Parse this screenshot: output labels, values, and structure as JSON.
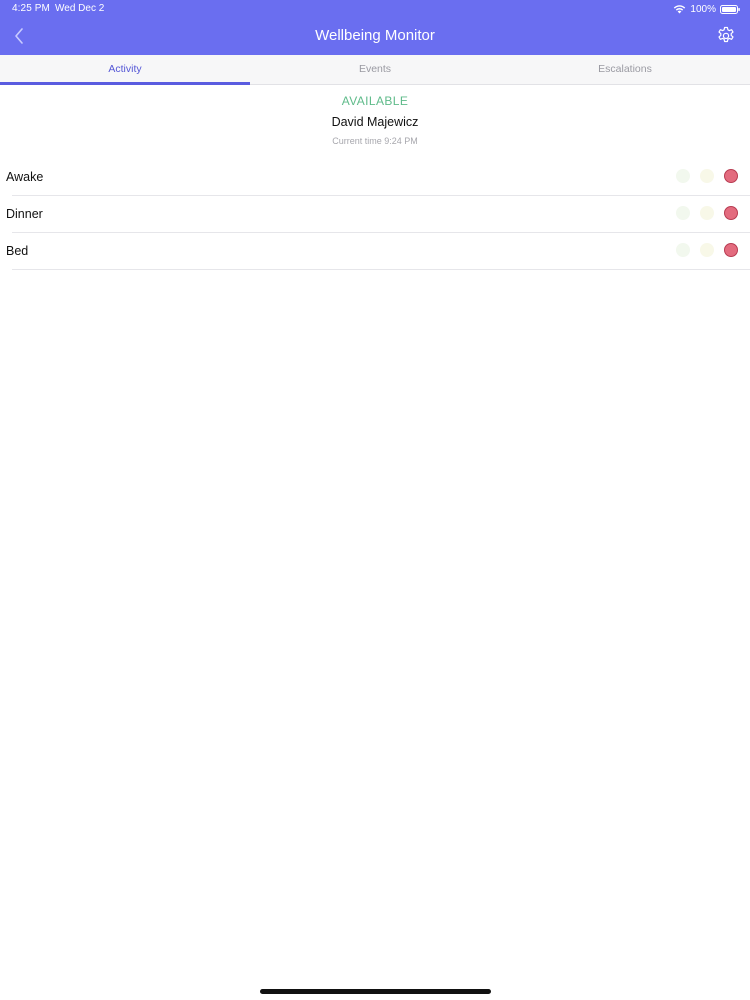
{
  "status_bar": {
    "time": "4:25 PM",
    "date": "Wed Dec 2",
    "battery_text": "100%",
    "wifi_icon": "wifi-icon",
    "battery_icon": "battery-full-icon"
  },
  "header": {
    "title": "Wellbeing Monitor",
    "back_icon": "chevron-left-icon",
    "settings_icon": "gear-icon",
    "background_color": "#6a6ef0"
  },
  "tabs": [
    {
      "label": "Activity",
      "active": true
    },
    {
      "label": "Events",
      "active": false
    },
    {
      "label": "Escalations",
      "active": false
    }
  ],
  "summary": {
    "status": "AVAILABLE",
    "status_color": "#5fbb8a",
    "name": "David Majewicz",
    "current_time": "Current time 9:24 PM"
  },
  "activities": [
    {
      "label": "Awake",
      "indicators": [
        "faint-green",
        "faint-yellow",
        "red"
      ]
    },
    {
      "label": "Dinner",
      "indicators": [
        "faint-green",
        "faint-yellow",
        "red"
      ]
    },
    {
      "label": "Bed",
      "indicators": [
        "faint-green",
        "faint-yellow",
        "red"
      ]
    }
  ]
}
